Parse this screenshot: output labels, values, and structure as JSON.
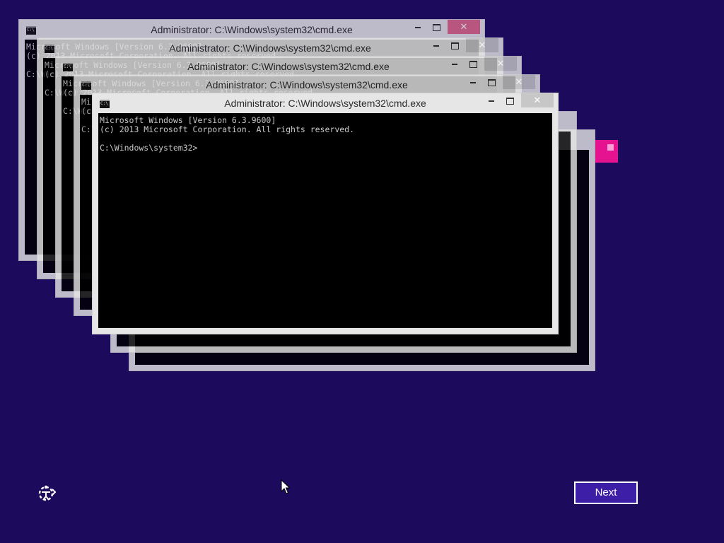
{
  "desktop": {
    "background_color": "#1c0a5c",
    "accent_color": "#e5138f"
  },
  "windows": [
    {
      "title": "Administrator: C:\\Windows\\system32\\cmd.exe",
      "icon_text": "C:\\",
      "minimize_icon": "minimize-icon",
      "maximize_icon": "maximize-icon",
      "close_glyph": "✕",
      "lines": [
        "Microsoft Windows [Version 6.3.9600]",
        "(c) 2013 Microsoft Corporation. All rights reserved.",
        "",
        "C:\\Windows\\system32>"
      ]
    }
  ],
  "footer": {
    "ease_of_access_icon": "ease-of-access-icon",
    "next_label": "Next"
  }
}
